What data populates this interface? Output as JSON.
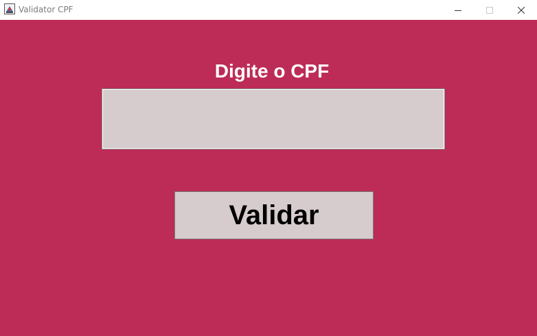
{
  "window": {
    "title": "Validator CPF",
    "icons": {
      "app": "java-app-icon",
      "minimize": "minimize-icon",
      "maximize": "maximize-icon",
      "close": "close-icon"
    }
  },
  "form": {
    "prompt": "Digite o CPF",
    "cpf_value": "",
    "cpf_placeholder": "",
    "validate_label": "Validar"
  },
  "colors": {
    "background": "#bc2c57",
    "field": "#d6cccd",
    "prompt_text": "#ffffff",
    "button_text": "#000000"
  }
}
